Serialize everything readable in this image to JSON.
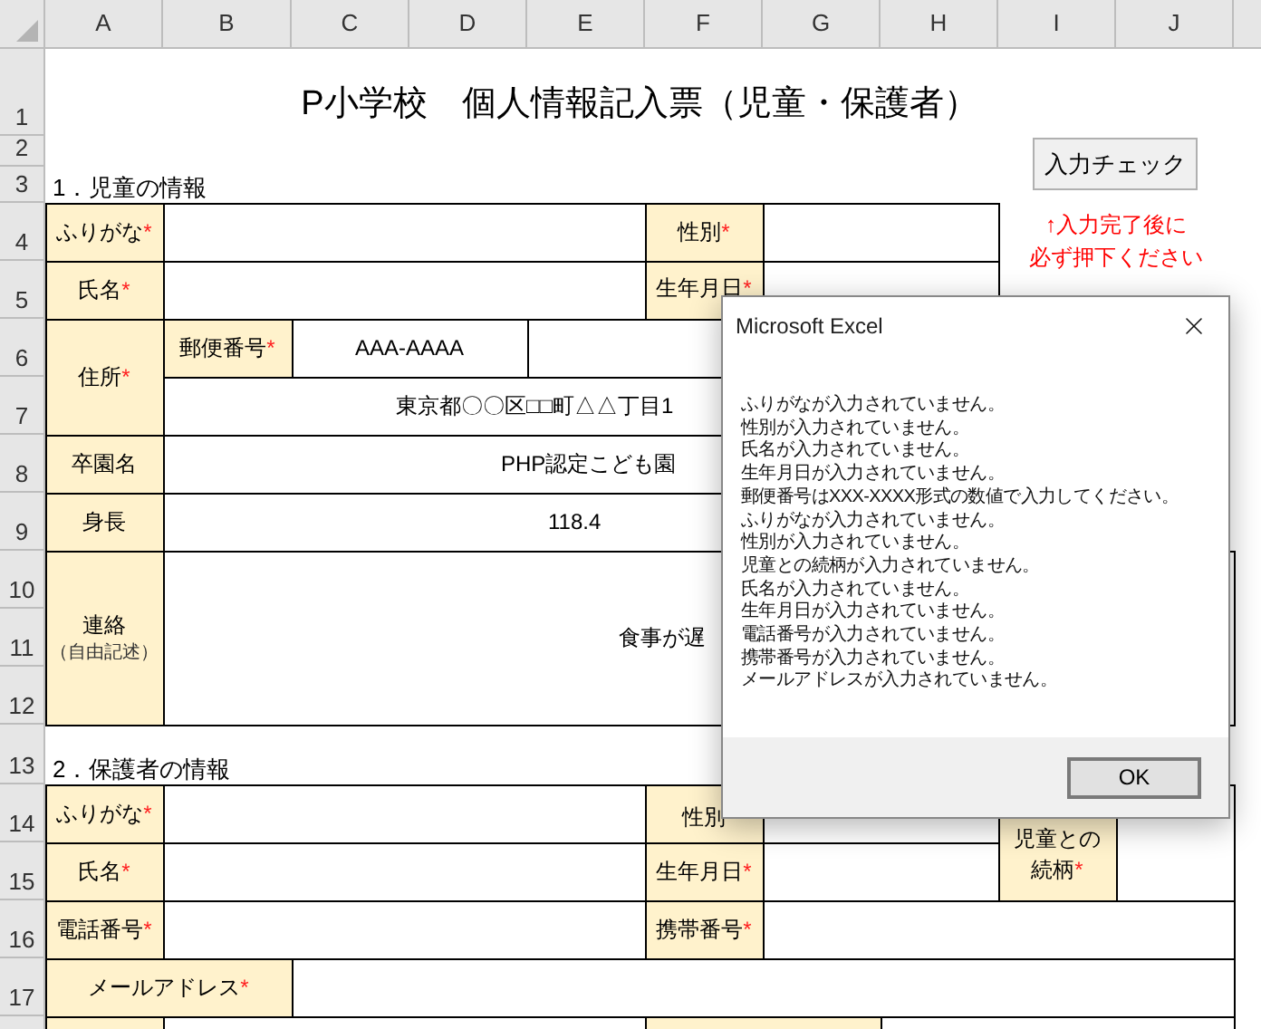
{
  "columns": [
    "A",
    "B",
    "C",
    "D",
    "E",
    "F",
    "G",
    "H",
    "I",
    "J"
  ],
  "row_numbers": [
    "1",
    "2",
    "3",
    "4",
    "5",
    "6",
    "7",
    "8",
    "9",
    "10",
    "11",
    "12",
    "13",
    "14",
    "15",
    "16",
    "17"
  ],
  "title": "P小学校　個人情報記入票（児童・保護者）",
  "check_button": {
    "label": "入力チェック"
  },
  "check_note": [
    "↑入力完了後に",
    "必ず押下ください"
  ],
  "sections": [
    "1．児童の情報",
    "2．保護者の情報"
  ],
  "required_mark": "*",
  "cells": [
    {
      "kind": "label",
      "text": "ふりがな",
      "required": true
    },
    {
      "kind": "value"
    },
    {
      "kind": "label",
      "text": "性別",
      "required": true
    },
    {
      "kind": "value"
    },
    {
      "kind": "label",
      "text": "氏名",
      "required": true
    },
    {
      "kind": "value"
    },
    {
      "kind": "label",
      "text": "生年月日",
      "required": true
    },
    {
      "kind": "value"
    },
    {
      "kind": "label",
      "text": "住所",
      "required": true
    },
    {
      "kind": "label",
      "text": "郵便番号",
      "required": true
    },
    {
      "kind": "value",
      "text": "AAA-AAAA"
    },
    {
      "kind": "value"
    },
    {
      "kind": "value",
      "text": "東京都〇〇区□□町△△丁目1"
    },
    {
      "kind": "label",
      "text": "卒園名",
      "required": false
    },
    {
      "kind": "value",
      "text": "PHP認定こども園"
    },
    {
      "kind": "label",
      "text": "身長",
      "required": false
    },
    {
      "kind": "value",
      "text": "118.4"
    },
    {
      "kind": "label",
      "text": "連絡",
      "note": "（自由記述）",
      "required": false
    },
    {
      "kind": "value",
      "text": "食事が遅"
    },
    {
      "kind": "label",
      "text": "ふりがな",
      "required": true
    },
    {
      "kind": "value"
    },
    {
      "kind": "label",
      "text": "性別",
      "required": false
    },
    {
      "kind": "value"
    },
    {
      "kind": "label",
      "text": "氏名",
      "required": true
    },
    {
      "kind": "value"
    },
    {
      "kind": "label",
      "text": "生年月日",
      "required": true
    },
    {
      "kind": "value"
    },
    {
      "kind": "label",
      "text": "児童との続柄",
      "required": true
    },
    {
      "kind": "value"
    },
    {
      "kind": "label",
      "text": "電話番号",
      "required": true
    },
    {
      "kind": "value"
    },
    {
      "kind": "label",
      "text": "携帯番号",
      "required": true
    },
    {
      "kind": "value"
    },
    {
      "kind": "label",
      "text": "メールアドレス",
      "required": true
    },
    {
      "kind": "value"
    },
    {
      "kind": "label"
    },
    {
      "kind": "value"
    },
    {
      "kind": "label"
    },
    {
      "kind": "value"
    }
  ],
  "dialog": {
    "title": "Microsoft Excel",
    "messages": [
      "ふりがなが入力されていません。",
      "性別が入力されていません。",
      "氏名が入力されていません。",
      "生年月日が入力されていません。",
      "郵便番号はXXX-XXXX形式の数値で入力してください。",
      "ふりがなが入力されていません。",
      "性別が入力されていません。",
      "児童との続柄が入力されていません。",
      "氏名が入力されていません。",
      "生年月日が入力されていません。",
      "電話番号が入力されていません。",
      "携帯番号が入力されていません。",
      "メールアドレスが入力されていません。"
    ],
    "buttons": [
      "OK"
    ]
  }
}
